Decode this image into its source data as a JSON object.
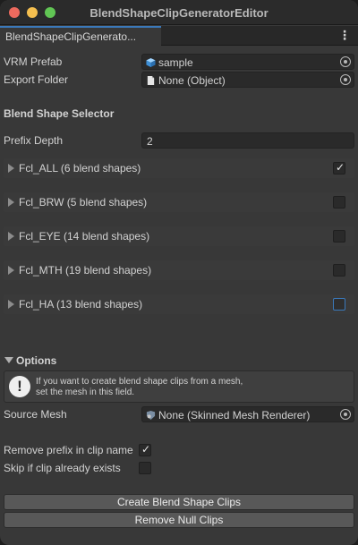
{
  "window": {
    "title": "BlendShapeClipGeneratorEditor"
  },
  "tab": {
    "label": "BlendShapeClipGenerato...",
    "menu_glyph": "⋮"
  },
  "vrm_prefab": {
    "label": "VRM Prefab",
    "value": "sample"
  },
  "export_folder": {
    "label": "Export Folder",
    "value": "None (Object)"
  },
  "selector": {
    "heading": "Blend Shape Selector",
    "prefix_depth_label": "Prefix Depth",
    "prefix_depth_value": "2",
    "groups": [
      {
        "label": "Fcl_ALL (6 blend shapes)",
        "checked": true
      },
      {
        "label": "Fcl_BRW (5 blend shapes)",
        "checked": false
      },
      {
        "label": "Fcl_EYE (14 blend shapes)",
        "checked": false
      },
      {
        "label": "Fcl_MTH (19 blend shapes)",
        "checked": false
      },
      {
        "label": "Fcl_HA (13 blend shapes)",
        "checked": false
      }
    ]
  },
  "options": {
    "heading": "Options",
    "help_line1": "If you want to create blend shape clips from a mesh,",
    "help_line2": "set the mesh in this field.",
    "source_mesh_label": "Source Mesh",
    "source_mesh_value": "None (Skinned Mesh Renderer)",
    "remove_prefix_label": "Remove prefix in clip name",
    "remove_prefix_checked": true,
    "skip_existing_label": "Skip if clip already exists",
    "skip_existing_checked": false
  },
  "buttons": {
    "create": "Create Blend Shape Clips",
    "remove_null": "Remove Null Clips"
  },
  "colors": {
    "accent": "#3a79bb",
    "background": "#383838"
  }
}
